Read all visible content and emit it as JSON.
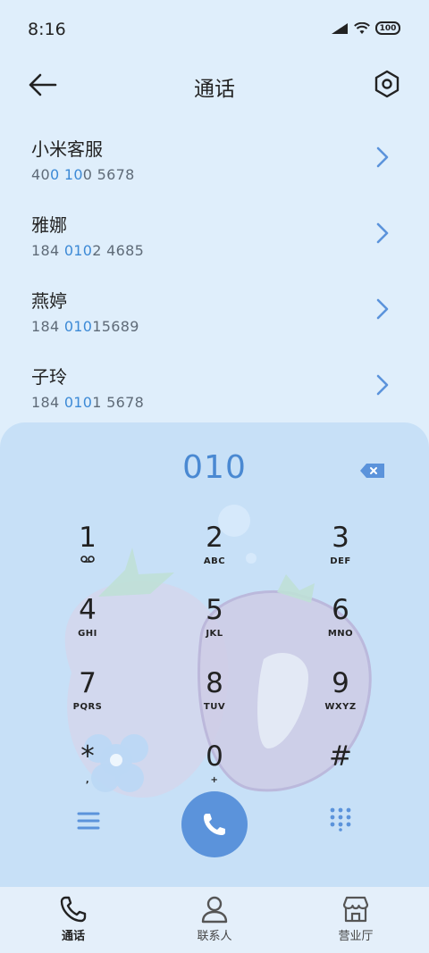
{
  "status_bar": {
    "time": "8:16",
    "battery": "100"
  },
  "header": {
    "title": "通话"
  },
  "contacts": [
    {
      "name": "小米客服",
      "number_pre": "40",
      "number_hl": "0 10",
      "number_post": "0 5678"
    },
    {
      "name": "雅娜",
      "number_pre": "184 ",
      "number_hl": "010",
      "number_post": "2 4685"
    },
    {
      "name": "燕婷",
      "number_pre": "184 ",
      "number_hl": "010",
      "number_post": "15689"
    },
    {
      "name": "子玲",
      "number_pre": "184 ",
      "number_hl": "010",
      "number_post": "1 5678"
    }
  ],
  "dialer": {
    "input_value": "010",
    "keys": [
      {
        "digit": "1",
        "letters": ""
      },
      {
        "digit": "2",
        "letters": "ABC"
      },
      {
        "digit": "3",
        "letters": "DEF"
      },
      {
        "digit": "4",
        "letters": "GHI"
      },
      {
        "digit": "5",
        "letters": "JKL"
      },
      {
        "digit": "6",
        "letters": "MNO"
      },
      {
        "digit": "7",
        "letters": "PQRS"
      },
      {
        "digit": "8",
        "letters": "TUV"
      },
      {
        "digit": "9",
        "letters": "WXYZ"
      },
      {
        "digit": "*",
        "letters": ","
      },
      {
        "digit": "0",
        "letters": "+"
      },
      {
        "digit": "#",
        "letters": ""
      }
    ]
  },
  "bottom_nav": [
    {
      "label": "通话",
      "icon": "phone-icon",
      "active": true
    },
    {
      "label": "联系人",
      "icon": "person-icon",
      "active": false
    },
    {
      "label": "营业厅",
      "icon": "store-icon",
      "active": false
    }
  ],
  "colors": {
    "accent": "#4a89d2",
    "call_button": "#5b93db",
    "highlight_number": "#3d8ad6"
  }
}
